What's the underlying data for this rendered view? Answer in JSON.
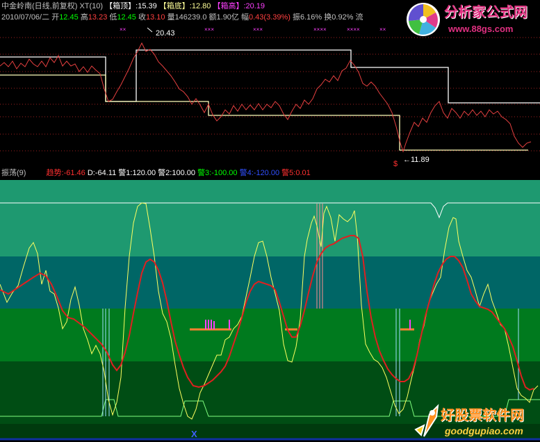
{
  "price_header": {
    "stock": "中金岭南(日线,前复权)",
    "indicator": "XT(10)",
    "box_top_label": "【箱顶】",
    "box_top_value": ":15.39",
    "box_bottom_label": "【箱底】",
    "box_bottom_value": ":12.80",
    "box_high_label": "【箱高】",
    "box_high_value": ":20.19",
    "date": "2010/07/06/二",
    "open_label": "开",
    "open_value": "12.45",
    "high_label": "高",
    "high_value": "13.23",
    "low_label": "低",
    "low_value": "12.45",
    "close_label": "收",
    "close_value": "13.10",
    "volume_label": "量",
    "volume_value": "146239.0",
    "amount_label": "额",
    "amount_value": "1.90亿",
    "change_label": "幅",
    "change_value": "0.43(3.39%)",
    "amplitude": "振6.16%",
    "turnover": "换0.92%",
    "float": "流"
  },
  "price_chart": {
    "high_annotation": "20.43",
    "low_annotation": "←11.89",
    "signal_mark": "$",
    "cross_marks": [
      "××",
      "×××",
      "×××",
      "××××",
      "××××",
      "××"
    ]
  },
  "osc_header": {
    "name": "振荡(9)",
    "trend_label": "趋势:",
    "trend_value": "-61.46",
    "d_label": "D:",
    "d_value": "-64.11",
    "warn1": "警1:120.00",
    "warn2": "警2:100.00",
    "warn3": "警3:-100.00",
    "warn4": "警4:-120.00",
    "warn5": "警5:0.01"
  },
  "logos": {
    "top_name": "分析家公式网",
    "top_url": "www.88gs.com",
    "bottom_name": "好股票软件网",
    "bottom_url": "goodgupiao.com"
  },
  "colors": {
    "white_text": "#c0c0c0",
    "price_line": "#e64040",
    "box_line": "#ffffff",
    "box_line2": "#ffff99",
    "magenta": "#ff40ff",
    "yellow": "#ffff00",
    "green": "#00ff00",
    "band1": "#1e9970",
    "band2": "#006666",
    "band3": "#007a1e",
    "band4": "#004d14",
    "band5": "#003a0e"
  }
}
